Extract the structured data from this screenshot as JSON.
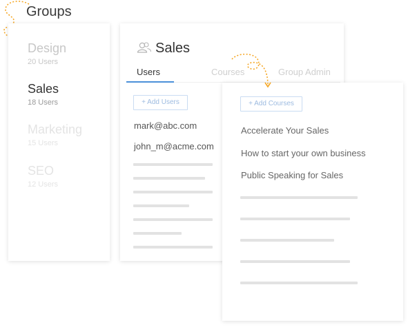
{
  "header": {
    "title": "Groups"
  },
  "groups": [
    {
      "name": "Design",
      "users": "20 Users",
      "state": "muted"
    },
    {
      "name": "Sales",
      "users": "18 Users",
      "state": "selected"
    },
    {
      "name": "Marketing",
      "users": "15 Users",
      "state": "faint"
    },
    {
      "name": "SEO",
      "users": "12 Users",
      "state": "faint"
    }
  ],
  "sales": {
    "title": "Sales",
    "tabs": [
      {
        "label": "Users",
        "active": true
      },
      {
        "label": "Courses",
        "active": false
      },
      {
        "label": "Group Admin",
        "active": false
      }
    ],
    "add_users_label": "+ Add Users",
    "emails": [
      "mark@abc.com",
      "john_m@acme.com"
    ]
  },
  "courses": {
    "add_courses_label": "+ Add Courses",
    "items": [
      "Accelerate Your Sales",
      "How to start your own business",
      "Public Speaking for Sales"
    ]
  },
  "colors": {
    "accent": "#4a90d9",
    "arrow": "#f5a623",
    "placeholder": "#e2e2e2"
  }
}
